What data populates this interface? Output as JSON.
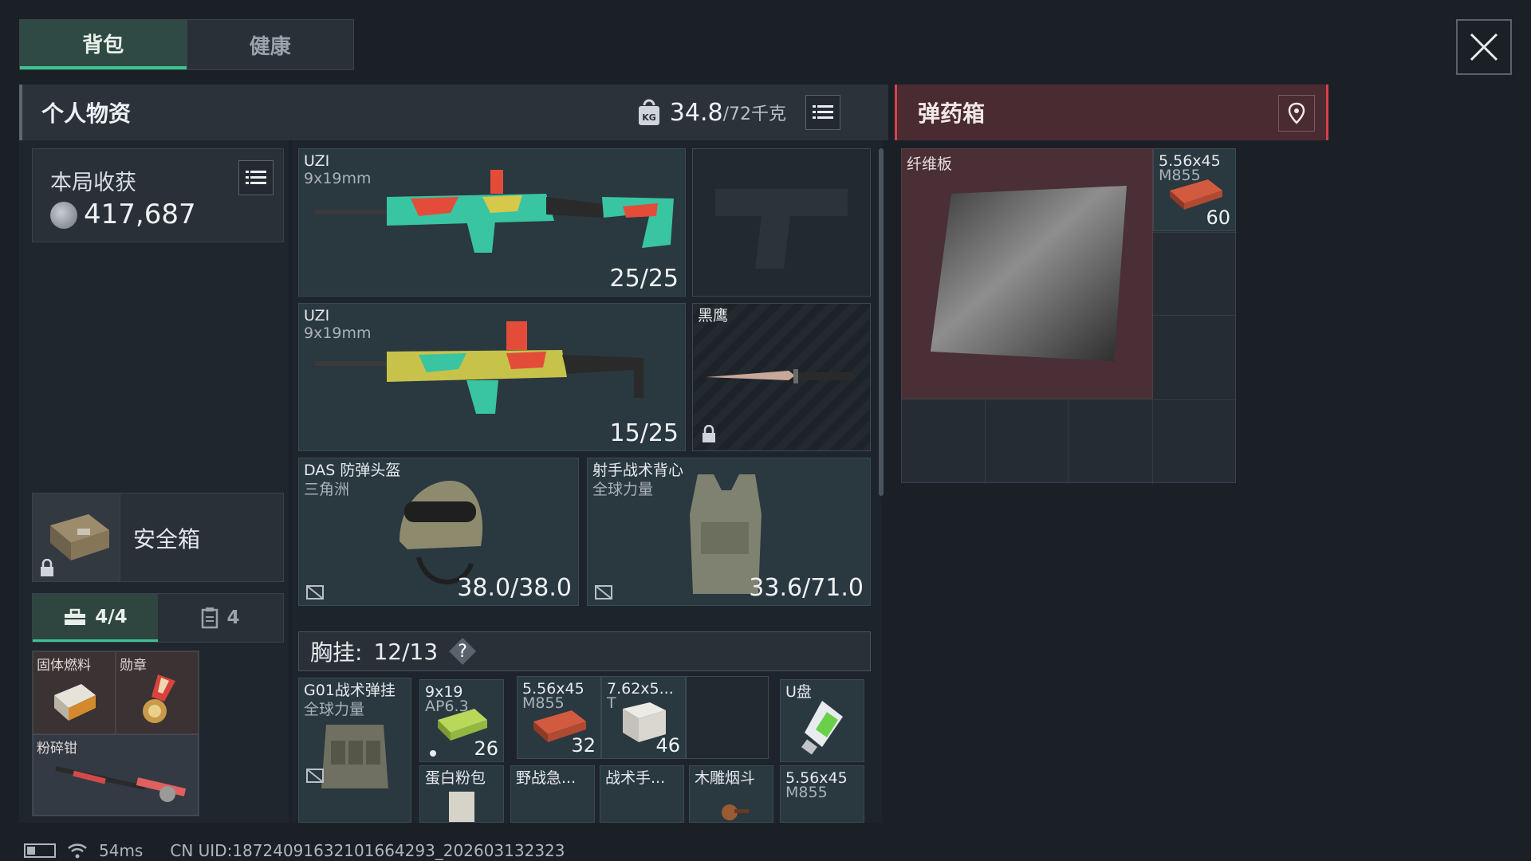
{
  "tabs": [
    {
      "label": "背包",
      "active": true
    },
    {
      "label": "健康",
      "active": false
    }
  ],
  "personal": {
    "title": "个人物资",
    "weight_current": "34.8",
    "weight_max": "/72千克"
  },
  "harvest": {
    "label": "本局收获",
    "value": "417,687"
  },
  "safe_box": {
    "label": "安全箱"
  },
  "sub_tabs": [
    {
      "label": "4/4",
      "icon": "toolbox-icon",
      "active": true
    },
    {
      "label": "4",
      "icon": "clipboard-icon",
      "active": false
    }
  ],
  "pouch_items": [
    {
      "name": "固体燃料"
    },
    {
      "name": "勋章"
    },
    {
      "name": "粉碎钳"
    }
  ],
  "weapons": [
    {
      "name": "UZI",
      "caliber": "9x19mm",
      "ammo": "25/25"
    },
    {
      "name": "UZI",
      "caliber": "9x19mm",
      "ammo": "15/25"
    }
  ],
  "knife": {
    "name": "黑鹰"
  },
  "armor": [
    {
      "name": "DAS 防弹头盔",
      "brand": "三角洲",
      "durability": "38.0/38.0"
    },
    {
      "name": "射手战术背心",
      "brand": "全球力量",
      "durability": "33.6/71.0"
    }
  ],
  "chest_rig": {
    "label": "胸挂:",
    "capacity": "12/13",
    "help": "?"
  },
  "rig_items": [
    {
      "name": "G01战术弹挂",
      "sub": "全球力量"
    },
    {
      "name": "9x19",
      "sub": "AP6.3",
      "qty": "26"
    },
    {
      "name": "5.56x45",
      "sub": "M855",
      "qty": "32"
    },
    {
      "name": "7.62x5...",
      "sub": "T",
      "qty": "46"
    },
    {
      "name": "U盘"
    },
    {
      "name": "蛋白粉包"
    },
    {
      "name": "野战急..."
    },
    {
      "name": "战术手..."
    },
    {
      "name": "木雕烟斗"
    },
    {
      "name": "5.56x45",
      "sub": "M855"
    }
  ],
  "ammo_box": {
    "title": "弹药箱",
    "items": [
      {
        "name": "纤维板"
      },
      {
        "name": "5.56x45",
        "sub": "M855",
        "qty": "60"
      }
    ]
  },
  "status": {
    "ping": "54ms",
    "uid": "CN UID:18724091632101664293_202603132323"
  },
  "colors": {
    "accent_green": "#3ec28f",
    "ammo_red": "#d4424a",
    "background": "#1b2026"
  }
}
